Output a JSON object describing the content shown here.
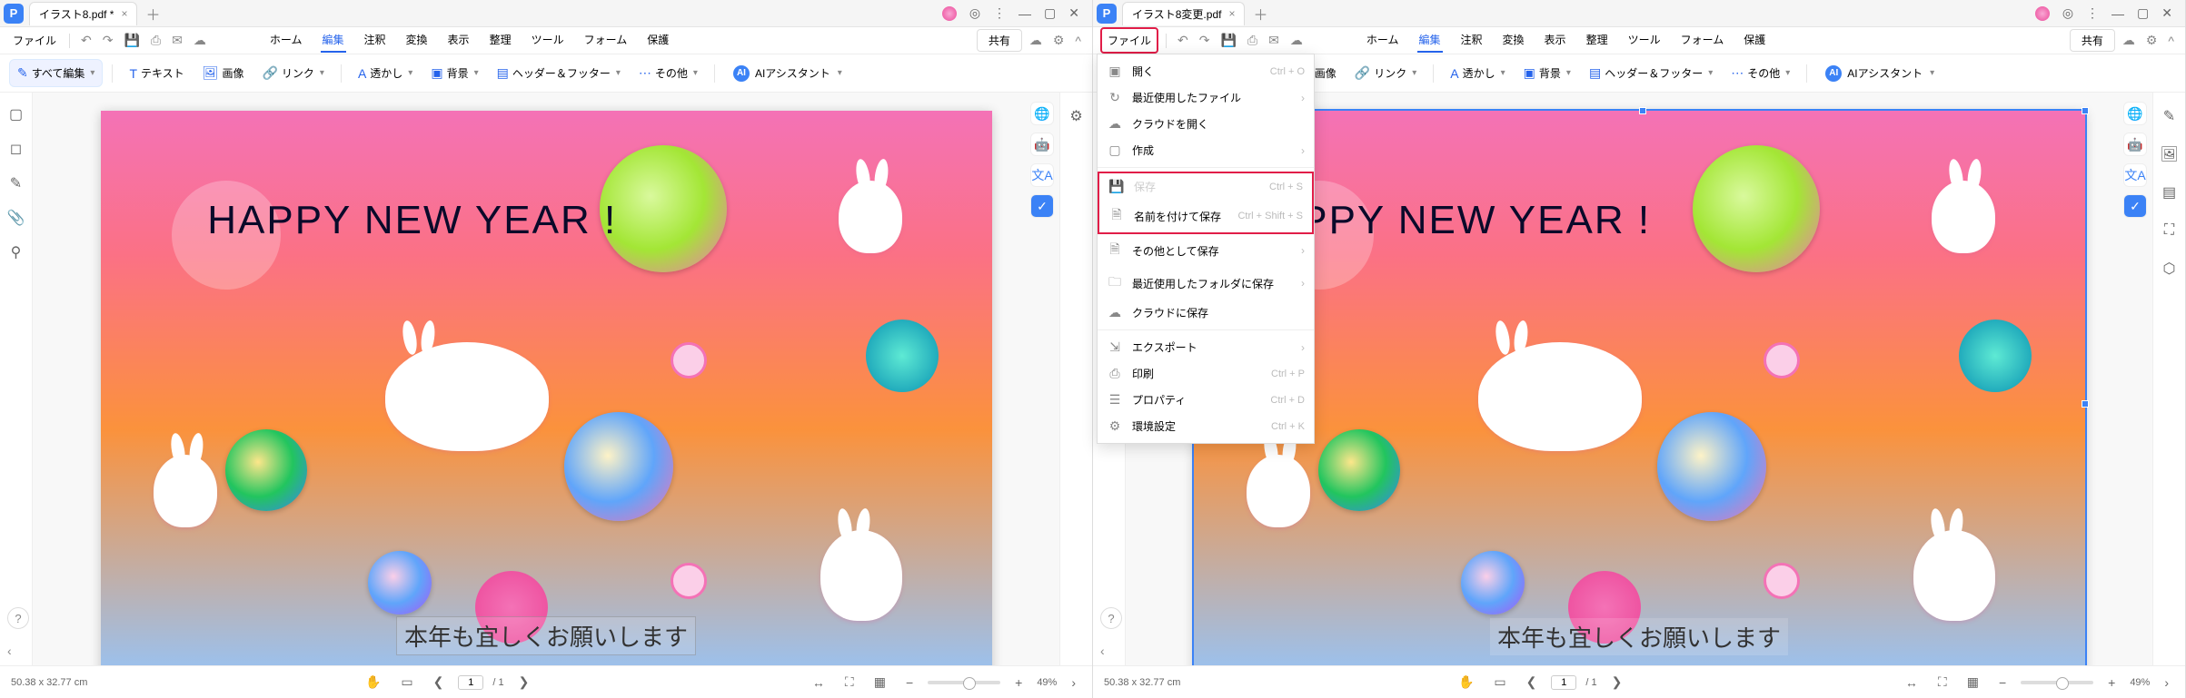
{
  "left": {
    "tab_title": "イラスト8.pdf *",
    "menubar": {
      "file": "ファイル"
    },
    "main_tabs": [
      "ホーム",
      "編集",
      "注釈",
      "変換",
      "表示",
      "整理",
      "ツール",
      "フォーム",
      "保護"
    ],
    "active_tab": "編集",
    "share": "共有",
    "toolbar": {
      "edit_all": "すべて編集",
      "text": "テキスト",
      "image": "画像",
      "link": "リンク",
      "watermark": "透かし",
      "background": "背景",
      "header_footer": "ヘッダー＆フッター",
      "other": "その他",
      "ai": "AIアシスタント"
    },
    "page": {
      "heading": "HAPPY NEW YEAR !",
      "footer": "本年も宜しくお願いします"
    },
    "status": {
      "dim": "50.38 x 32.77 cm",
      "page_current": "1",
      "page_total": "/ 1",
      "zoom": "49%"
    }
  },
  "right": {
    "tab_title": "イラスト8変更.pdf",
    "menubar": {
      "file": "ファイル"
    },
    "main_tabs": [
      "ホーム",
      "編集",
      "注釈",
      "変換",
      "表示",
      "整理",
      "ツール",
      "フォーム",
      "保護"
    ],
    "active_tab": "編集",
    "share": "共有",
    "toolbar": {
      "image": "画像",
      "link": "リンク",
      "watermark": "透かし",
      "background": "背景",
      "header_footer": "ヘッダー＆フッター",
      "other": "その他",
      "ai": "AIアシスタント"
    },
    "dropdown": {
      "open": "開く",
      "open_sc": "Ctrl + O",
      "recent": "最近使用したファイル",
      "cloud_open": "クラウドを開く",
      "create": "作成",
      "save": "保存",
      "save_sc": "Ctrl + S",
      "save_as": "名前を付けて保存",
      "save_as_sc": "Ctrl + Shift + S",
      "save_other": "その他として保存",
      "recent_folder": "最近使用したフォルダに保存",
      "cloud_save": "クラウドに保存",
      "export": "エクスポート",
      "print": "印刷",
      "print_sc": "Ctrl + P",
      "properties": "プロパティ",
      "properties_sc": "Ctrl + D",
      "prefs": "環境設定",
      "prefs_sc": "Ctrl + K"
    },
    "page": {
      "heading": "PPY NEW YEAR !",
      "footer": "本年も宜しくお願いします"
    },
    "status": {
      "dim": "50.38 x 32.77 cm",
      "page_current": "1",
      "page_total": "/ 1",
      "zoom": "49%"
    }
  }
}
